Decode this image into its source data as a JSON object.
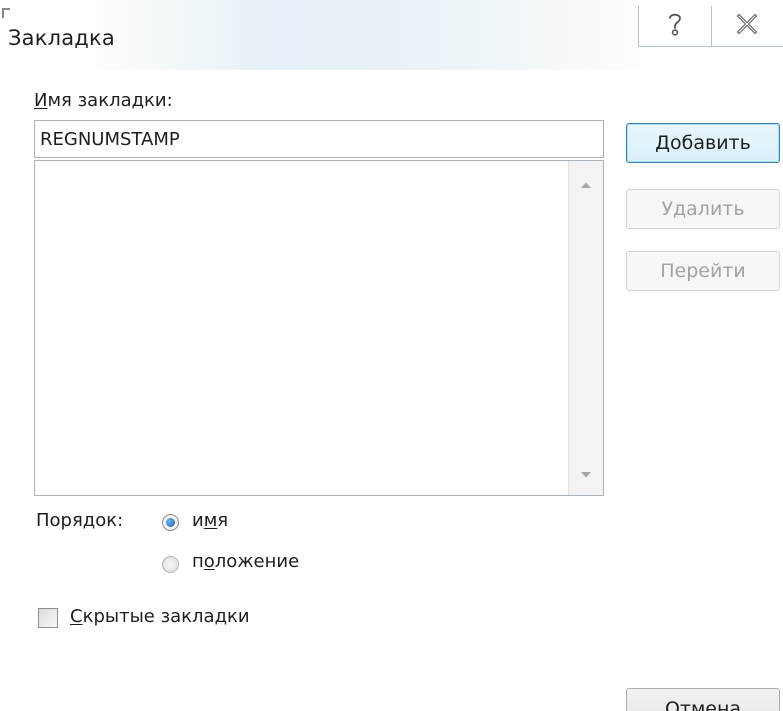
{
  "dialog": {
    "title": "Закладка"
  },
  "title_buttons": {
    "help_icon": "help-icon",
    "close_icon": "close-icon"
  },
  "name_field": {
    "label_first": "И",
    "label_rest": "мя закладки:",
    "value": "REGNUMSTAMP"
  },
  "bookmark_list": {
    "items": []
  },
  "buttons": {
    "add_first": "Д",
    "add_rest": "обавить",
    "delete": "Удалить",
    "goto": "Перейти",
    "cancel": "Отмена"
  },
  "sort": {
    "label": "Порядок:",
    "option_name_before": "и",
    "option_name_underlined": "м",
    "option_name_after": "я",
    "option_position_before": "п",
    "option_position_underlined": "о",
    "option_position_after": "ложение",
    "selected": "имя"
  },
  "hidden_bookmarks": {
    "label_first": "С",
    "label_rest": "крытые закладки",
    "checked": false
  },
  "colors": {
    "accent": "#3c7fb1",
    "disabled_text": "#a3a3a3"
  }
}
